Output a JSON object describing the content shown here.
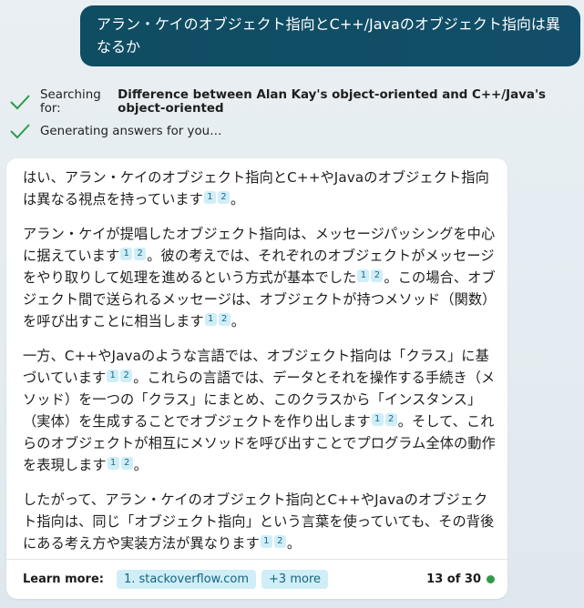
{
  "user_message": "アラン・ケイのオブジェクト指向とC++/Javaのオブジェクト指向は異なるか",
  "status": {
    "searching_prefix": "Searching for:",
    "searching_query": "Difference between Alan Kay's object-oriented and C++/Java's object-oriented",
    "generating": "Generating answers for you…"
  },
  "answer": {
    "p1": {
      "text": "はい、アラン・ケイのオブジェクト指向とC++やJavaのオブジェクト指向は異なる視点を持っています",
      "end": "。"
    },
    "p2": {
      "s1": "アラン・ケイが提唱したオブジェクト指向は、メッセージパッシングを中心に据えています",
      "s2": "。彼の考えでは、それぞれのオブジェクトがメッセージをやり取りして処理を進めるという方式が基本でした",
      "s3": "。この場合、オブジェクト間で送られるメッセージは、オブジェクトが持つメソッド（関数）を呼び出すことに相当します",
      "end": "。"
    },
    "p3": {
      "s1": "一方、C++やJavaのような言語では、オブジェクト指向は「クラス」に基づいています",
      "s2": "。これらの言語では、データとそれを操作する手続き（メソッド）を一つの「クラス」にまとめ、このクラスから「インスタンス」（実体）を生成することでオブジェクトを作り出します",
      "s3": "。そして、これらのオブジェクトが相互にメソッドを呼び出すことでプログラム全体の動作を表現します",
      "end": "。"
    },
    "p4": {
      "text": "したがって、アラン・ケイのオブジェクト指向とC++やJavaのオブジェクト指向は、同じ「オブジェクト指向」という言葉を使っていても、その背後にある考え方や実装方法が異なります",
      "end": "。"
    },
    "cite1": "1",
    "cite2": "2"
  },
  "footer": {
    "learn_more": "Learn more:",
    "source1": "1. stackoverflow.com",
    "more": "+3 more",
    "counter": "13 of 30"
  },
  "colors": {
    "user_bubble": "#124e69",
    "citation_bg": "#cfeef8",
    "check": "#2e9a4a",
    "status_dot": "#2e9a4a"
  }
}
